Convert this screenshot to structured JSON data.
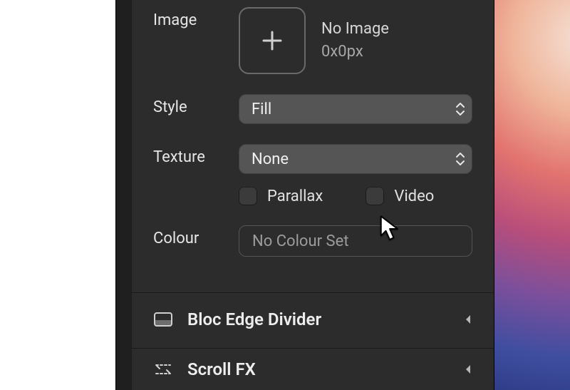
{
  "background": {
    "image": {
      "label": "Image",
      "placeholder_title": "No Image",
      "placeholder_size": "0x0px"
    },
    "style": {
      "label": "Style",
      "value": "Fill"
    },
    "texture": {
      "label": "Texture",
      "value": "None"
    },
    "options": {
      "parallax_label": "Parallax",
      "parallax_checked": false,
      "video_label": "Video",
      "video_checked": false
    },
    "colour": {
      "label": "Colour",
      "value": "No Colour Set"
    }
  },
  "sections": {
    "bloc_edge_divider": {
      "title": "Bloc Edge Divider"
    },
    "scroll_fx": {
      "title": "Scroll FX"
    }
  }
}
